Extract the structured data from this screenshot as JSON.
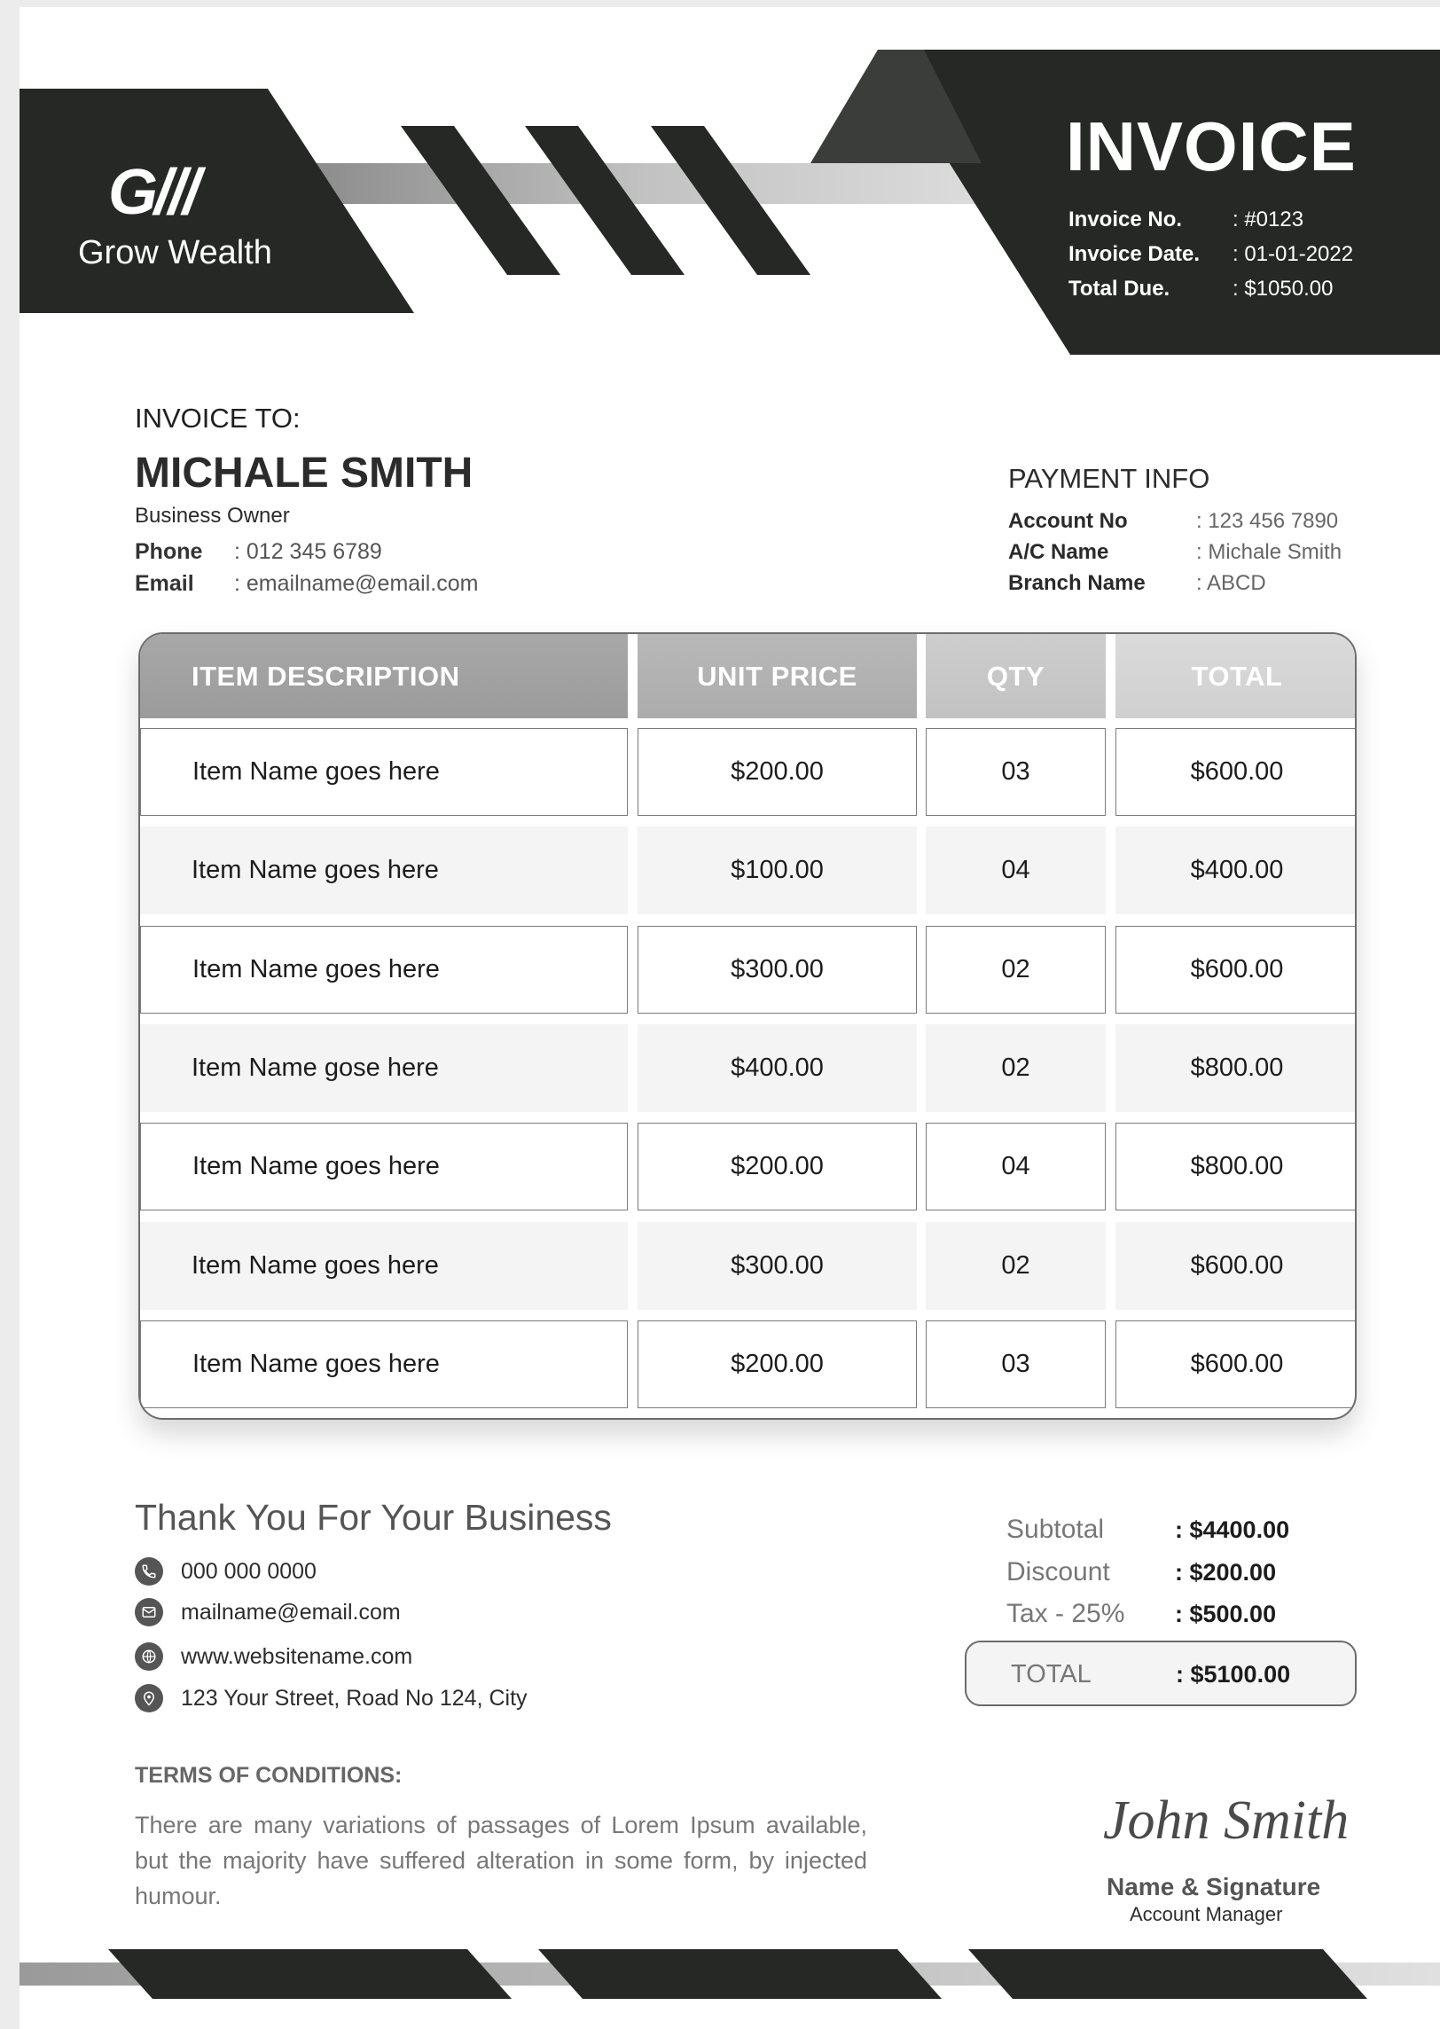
{
  "brand": {
    "mark": "G///",
    "name": "Grow Wealth"
  },
  "invoice": {
    "title": "INVOICE",
    "meta": [
      {
        "label": "Invoice No.",
        "value": ": #0123"
      },
      {
        "label": "Invoice Date.",
        "value": ": 01-01-2022"
      },
      {
        "label": "Total Due.",
        "value": ": $1050.00"
      }
    ]
  },
  "bill_to": {
    "heading": "INVOICE TO:",
    "name": "MICHALE SMITH",
    "role": "Business Owner",
    "phone_label": "Phone",
    "phone": ": 012 345 6789",
    "email_label": "Email",
    "email": ": emailname@email.com"
  },
  "payment": {
    "heading": "PAYMENT INFO",
    "rows": [
      {
        "label": "Account No",
        "value": ": 123 456 7890"
      },
      {
        "label": "A/C Name",
        "value": ": Michale Smith"
      },
      {
        "label": "Branch Name",
        "value": ": ABCD"
      }
    ]
  },
  "table": {
    "headers": [
      "ITEM DESCRIPTION",
      "UNIT PRICE",
      "QTY",
      "TOTAL"
    ],
    "rows": [
      [
        "Item Name goes here",
        "$200.00",
        "03",
        "$600.00"
      ],
      [
        "Item Name goes here",
        "$100.00",
        "04",
        "$400.00"
      ],
      [
        "Item Name goes here",
        "$300.00",
        "02",
        "$600.00"
      ],
      [
        "Item Name gose here",
        "$400.00",
        "02",
        "$800.00"
      ],
      [
        "Item Name goes here",
        "$200.00",
        "04",
        "$800.00"
      ],
      [
        "Item Name goes here",
        "$300.00",
        "02",
        "$600.00"
      ],
      [
        "Item Name goes here",
        "$200.00",
        "03",
        "$600.00"
      ]
    ]
  },
  "thanks": "Thank You For Your Business",
  "contacts": [
    {
      "icon": "phone-icon",
      "text": "000 000 0000"
    },
    {
      "icon": "mail-icon",
      "text": "mailname@email.com"
    },
    {
      "icon": "globe-icon",
      "text": "www.websitename.com"
    },
    {
      "icon": "location-pin-icon",
      "text": "123 Your Street, Road No 124, City"
    }
  ],
  "summary": {
    "rows": [
      {
        "label": "Subtotal",
        "value": ": $4400.00"
      },
      {
        "label": "Discount",
        "value": ": $200.00"
      },
      {
        "label": "Tax - 25%",
        "value": ": $500.00"
      }
    ],
    "total_label": "TOTAL",
    "total_value": ": $5100.00"
  },
  "terms": {
    "heading": "TERMS OF CONDITIONS:",
    "text": "There are many variations of passages of Lorem Ipsum available, but the majority have suffered alteration in some form, by injected humour."
  },
  "signature": {
    "signed": "John Smith",
    "label": "Name & Signature",
    "role": "Account Manager"
  },
  "colors": {
    "dark": "#262826",
    "gray_band": "#c9c9c9",
    "light_row": "#f4f4f4"
  }
}
